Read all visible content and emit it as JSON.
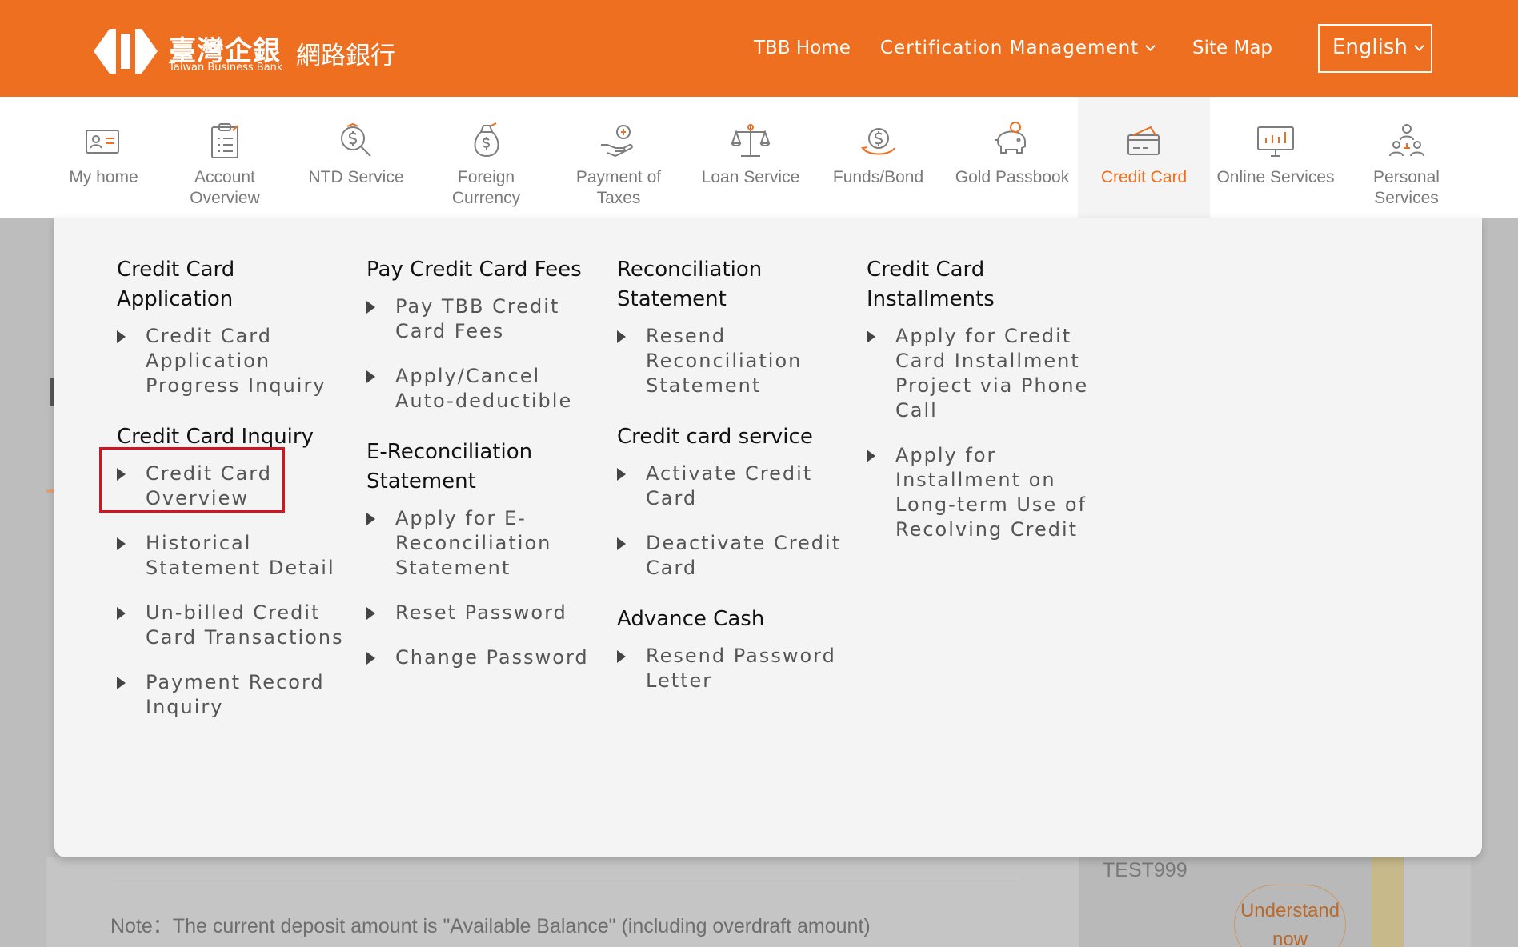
{
  "header": {
    "brand_zh": "臺灣企銀",
    "brand_en": "Taiwan Business Bank",
    "brand_sub": "網路銀行",
    "links": [
      "TBB Home",
      "Certification Management",
      "Site Map"
    ],
    "language": "English",
    "brand_color": "#ee6f1f"
  },
  "nav": {
    "items": [
      {
        "label": "My home",
        "icon": "profile-card-icon"
      },
      {
        "label": "Account Overview",
        "icon": "clipboard-list-icon"
      },
      {
        "label": "NTD Service",
        "icon": "coin-search-icon"
      },
      {
        "label": "Foreign Currency",
        "icon": "money-bag-icon"
      },
      {
        "label": "Payment of Taxes",
        "icon": "hand-coin-icon"
      },
      {
        "label": "Loan Service",
        "icon": "scales-icon"
      },
      {
        "label": "Funds/Bond",
        "icon": "coin-cycle-icon"
      },
      {
        "label": "Gold Passbook",
        "icon": "piggy-bank-icon"
      },
      {
        "label": "Credit Card",
        "icon": "credit-card-icon",
        "active": true
      },
      {
        "label": "Online Services",
        "icon": "monitor-chart-icon"
      },
      {
        "label": "Personal Services",
        "icon": "people-group-icon"
      }
    ]
  },
  "menu": {
    "columns": [
      {
        "sections": [
          {
            "title": "Credit Card Application",
            "items": [
              "Credit Card Application Progress Inquiry"
            ]
          },
          {
            "title": "Credit Card Inquiry",
            "items": [
              "Credit Card Overview",
              "Historical Statement Detail",
              "Un-billed Credit Card Transactions",
              "Payment Record Inquiry"
            ]
          }
        ]
      },
      {
        "sections": [
          {
            "title": "Pay Credit Card Fees",
            "items": [
              "Pay TBB Credit Card Fees",
              "Apply/Cancel Auto-deductible"
            ]
          },
          {
            "title": "E-Reconciliation Statement",
            "items": [
              "Apply for E-Reconciliation Statement",
              "Reset Password",
              "Change Password"
            ]
          }
        ]
      },
      {
        "sections": [
          {
            "title": "Reconciliation Statement",
            "items": [
              "Resend Reconciliation Statement"
            ]
          },
          {
            "title": "Credit card service",
            "items": [
              "Activate Credit Card",
              "Deactivate Credit Card"
            ]
          },
          {
            "title": "Advance Cash",
            "items": [
              "Resend Password Letter"
            ]
          }
        ]
      },
      {
        "sections": [
          {
            "title": "Credit Card Installments",
            "items": [
              "Apply for Credit Card Installment Project via Phone Call",
              "Apply for Installment on Long-term Use of Recolving Credit"
            ]
          }
        ]
      }
    ],
    "highlighted_item": "Credit Card Overview",
    "highlight_color": "#d0161e"
  },
  "background": {
    "note": "Note：The current deposit amount is \"Available Balance\" (including overdraft amount)",
    "account": "TEST999",
    "understand_label": "Understand now"
  }
}
